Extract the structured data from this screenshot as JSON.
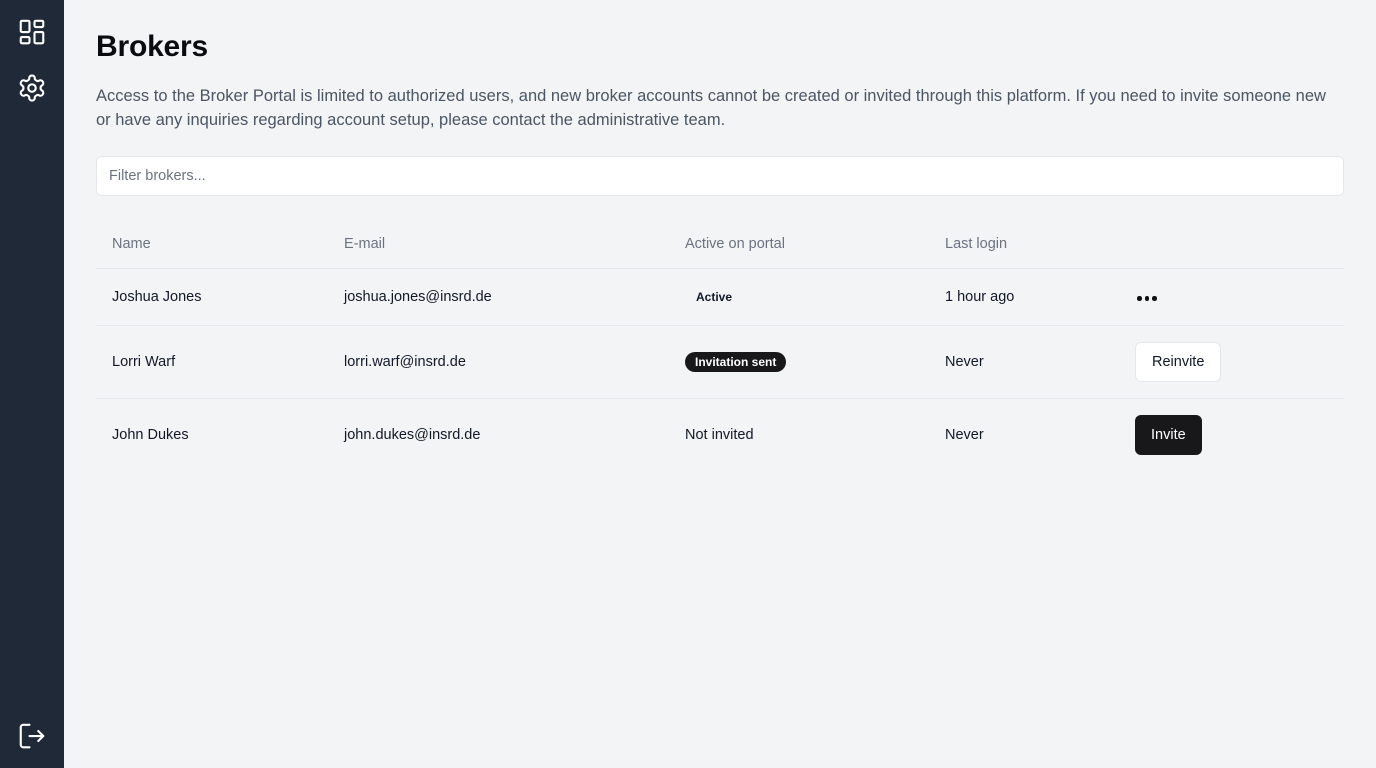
{
  "sidebar": {
    "top_icons": [
      "dashboard-icon",
      "gear-icon"
    ],
    "bottom_icon": "logout-icon"
  },
  "page": {
    "title": "Brokers",
    "description": "Access to the Broker Portal is limited to authorized users, and new broker accounts cannot be created or invited through this platform. If you need to invite someone new or have any inquiries regarding account setup, please contact the administrative team."
  },
  "filter": {
    "placeholder": "Filter brokers...",
    "value": ""
  },
  "table": {
    "headers": [
      "Name",
      "E-mail",
      "Active on portal",
      "Last login",
      ""
    ],
    "rows": [
      {
        "name": "Joshua Jones",
        "email": "joshua.jones@insrd.de",
        "status": "Active",
        "status_style": "outline",
        "last_login": "1 hour ago",
        "action": "more-icon"
      },
      {
        "name": "Lorri Warf",
        "email": "lorri.warf@insrd.de",
        "status": "Invitation sent",
        "status_style": "dark",
        "last_login": "Never",
        "action": "Reinvite"
      },
      {
        "name": "John Dukes",
        "email": "john.dukes@insrd.de",
        "status": "Not invited",
        "status_style": "plain",
        "last_login": "Never",
        "action": "Invite"
      }
    ]
  },
  "colors": {
    "sidebar_bg": "#1f2937",
    "page_bg": "#f3f4f6",
    "primary_button": "#18181b"
  }
}
